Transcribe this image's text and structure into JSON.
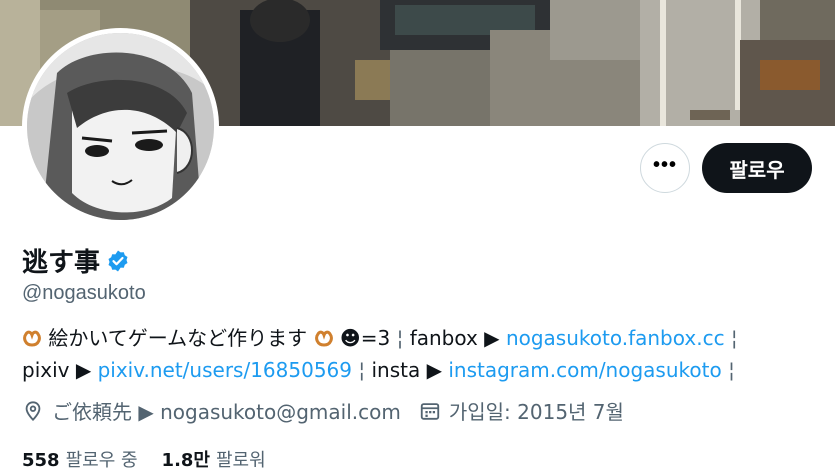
{
  "profile": {
    "display_name": "逃す事",
    "handle": "@nogasukoto",
    "bio_line1": {
      "text1": "絵かいてゲームなど作ります",
      "text2": "☻=3",
      "sep1": "¦",
      "fanbox_label": "fanbox ▶",
      "fanbox_link": "nogasukoto.fanbox.cc",
      "sep2": "¦"
    },
    "bio_line2": {
      "pixiv_label": "pixiv ▶",
      "pixiv_link": "pixiv.net/users/16850569",
      "sep1": "¦",
      "insta_label": "insta ▶",
      "insta_link": "instagram.com/nogasukoto",
      "sep2": "¦"
    },
    "location": "ご依頼先 ▶ nogasukoto@gmail.com",
    "joined": "가입일: 2015년 7월"
  },
  "actions": {
    "more_label": "•••",
    "follow_label": "팔로우"
  },
  "stats": {
    "following_count": "558",
    "following_label": "팔로우 중",
    "followers_count": "1.8만",
    "followers_label": "팔로워"
  },
  "icons": {
    "more": "more-horizontal-icon",
    "verified": "verified-badge-icon",
    "location": "location-pin-icon",
    "calendar": "calendar-icon",
    "pretzel": "pretzel-emoji-icon"
  },
  "colors": {
    "link": "#1d9bf0",
    "text": "#0f1419",
    "secondary": "#536471",
    "verified": "#1d9bf0"
  }
}
